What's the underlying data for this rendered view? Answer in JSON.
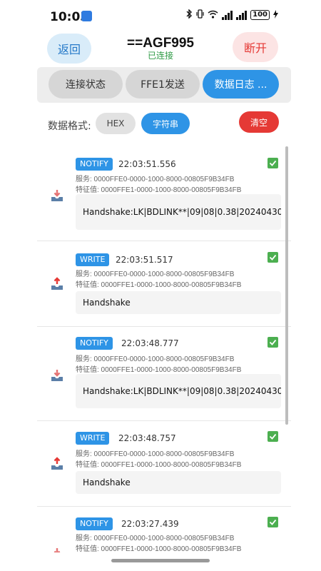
{
  "status_bar": {
    "time": "10:03",
    "battery": "100"
  },
  "header": {
    "back_label": "返回",
    "device_name": "==AGF995",
    "connection_status": "已连接",
    "disconnect_label": "断开"
  },
  "tabs": [
    {
      "label": "连接状态",
      "active": false
    },
    {
      "label": "FFE1发送",
      "active": false
    },
    {
      "label": "数据日志 ...",
      "active": true
    }
  ],
  "format": {
    "label": "数据格式:",
    "options": [
      "HEX",
      "字符串"
    ],
    "selected": "字符串",
    "clear_label": "清空"
  },
  "logs": [
    {
      "type": "NOTIFY",
      "direction": "in",
      "time": "22:03:51.556",
      "service": "服务: 0000FFE0-0000-1000-8000-00805F9B34FB",
      "characteristic": "特征值: 0000FFE1-0000-1000-8000-00805F9B34FB",
      "data": "Handshake:LK|BDLINK**|09|08|0.38|20240430",
      "status": "ok"
    },
    {
      "type": "WRITE",
      "direction": "out",
      "time": "22:03:51.517",
      "service": "服务: 0000FFE0-0000-1000-8000-00805F9B34FB",
      "characteristic": "特征值: 0000FFE1-0000-1000-8000-00805F9B34FB",
      "data": "Handshake",
      "status": "ok"
    },
    {
      "type": "NOTIFY",
      "direction": "in",
      "time": "22:03:48.777",
      "service": "服务: 0000FFE0-0000-1000-8000-00805F9B34FB",
      "characteristic": "特征值: 0000FFE1-0000-1000-8000-00805F9B34FB",
      "data": "Handshake:LK|BDLINK**|09|08|0.38|20240430",
      "status": "ok"
    },
    {
      "type": "WRITE",
      "direction": "out",
      "time": "22:03:48.757",
      "service": "服务: 0000FFE0-0000-1000-8000-00805F9B34FB",
      "characteristic": "特征值: 0000FFE1-0000-1000-8000-00805F9B34FB",
      "data": "Handshake",
      "status": "ok"
    },
    {
      "type": "NOTIFY",
      "direction": "in",
      "time": "22:03:27.439",
      "service": "服务: 0000FFE0-0000-1000-8000-00805F9B34FB",
      "characteristic": "特征值: 0000FFE1-0000-1000-8000-00805F9B34FB",
      "data": "",
      "status": "ok"
    }
  ],
  "colors": {
    "accent": "#2e94e6",
    "danger": "#e53935",
    "success": "#2e9b45",
    "check": "#4caf50",
    "arrow_in": "#e57373",
    "arrow_out": "#e53935",
    "tray": "#5b7fa8"
  }
}
